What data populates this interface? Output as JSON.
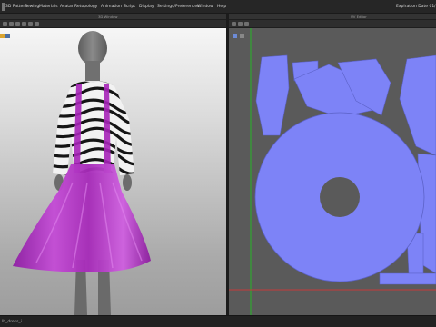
{
  "menu": [
    "3D Pattern",
    "Sewing",
    "Materials",
    "Avatar",
    "Retopology",
    "Animation",
    "Script",
    "Display",
    "Settings/Preferences",
    "Window",
    "Help"
  ],
  "expiry_text": "Expiration Date 01/19/2",
  "panels": {
    "left_title": "3D Window",
    "right_title": "UV Editor"
  },
  "status_text": "lb_dress_i",
  "colors": {
    "dress": "#b62fc7",
    "uv_island": "#7d83f7",
    "uv_background": "#5a5a5a",
    "axis_green": "#27b527",
    "axis_red": "#c53a3a"
  }
}
